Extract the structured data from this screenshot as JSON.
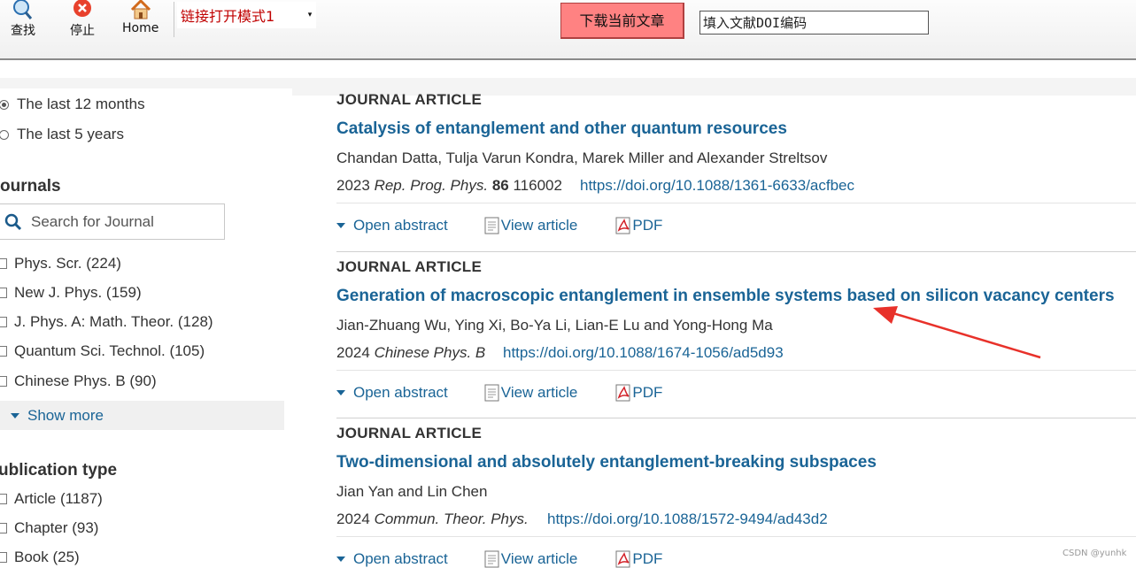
{
  "toolbar": {
    "find_label": "查找",
    "stop_label": "停止",
    "home_label": "Home",
    "mode_value": "链接打开模式1",
    "download_label": "下载当前文章",
    "doi_placeholder": "填入文献DOI编码"
  },
  "sidebar": {
    "date_options": [
      {
        "label": "The last 12 months",
        "selected": true
      },
      {
        "label": "The last 5 years",
        "selected": false
      }
    ],
    "journals_title": "ournals",
    "journal_search_placeholder": "Search for Journal",
    "journals": [
      "Phys. Scr. (224)",
      "New J. Phys. (159)",
      "J. Phys. A: Math. Theor. (128)",
      "Quantum Sci. Technol. (105)",
      "Chinese Phys. B (90)"
    ],
    "show_more": "Show more",
    "pubtype_title": "ublication type",
    "pubtypes": [
      "Article (1187)",
      "Chapter (93)",
      "Book (25)"
    ]
  },
  "results": [
    {
      "type": "JOURNAL ARTICLE",
      "title": "Catalysis of entanglement and other quantum resources",
      "authors": "Chandan Datta, Tulja Varun Kondra, Marek Miller and Alexander Streltsov",
      "year": "2023",
      "journal": "Rep. Prog. Phys.",
      "volume": "86",
      "article_no": "116002",
      "doi": "https://doi.org/10.1088/1361-6633/acfbec"
    },
    {
      "type": "JOURNAL ARTICLE",
      "title": "Generation of macroscopic entanglement in ensemble systems based on silicon vacancy centers",
      "authors": "Jian-Zhuang Wu, Ying Xi, Bo-Ya Li, Lian-E Lu and Yong-Hong Ma",
      "year": "2024",
      "journal": "Chinese Phys. B",
      "volume": "",
      "article_no": "",
      "doi": "https://doi.org/10.1088/1674-1056/ad5d93"
    },
    {
      "type": "JOURNAL ARTICLE",
      "title": "Two-dimensional and absolutely entanglement-breaking subspaces",
      "authors": "Jian Yan and Lin Chen",
      "year": "2024",
      "journal": "Commun. Theor. Phys.",
      "volume": "",
      "article_no": "",
      "doi": "https://doi.org/10.1088/1572-9494/ad43d2"
    }
  ],
  "actions": {
    "open_abstract": "Open abstract",
    "view_article": "View article",
    "pdf": "PDF"
  },
  "watermark": "CSDN @yunhk",
  "colors": {
    "link": "#1a6496",
    "download_btn": "#ff8282",
    "mode_text": "#c00000",
    "arrow": "#e8312a"
  }
}
